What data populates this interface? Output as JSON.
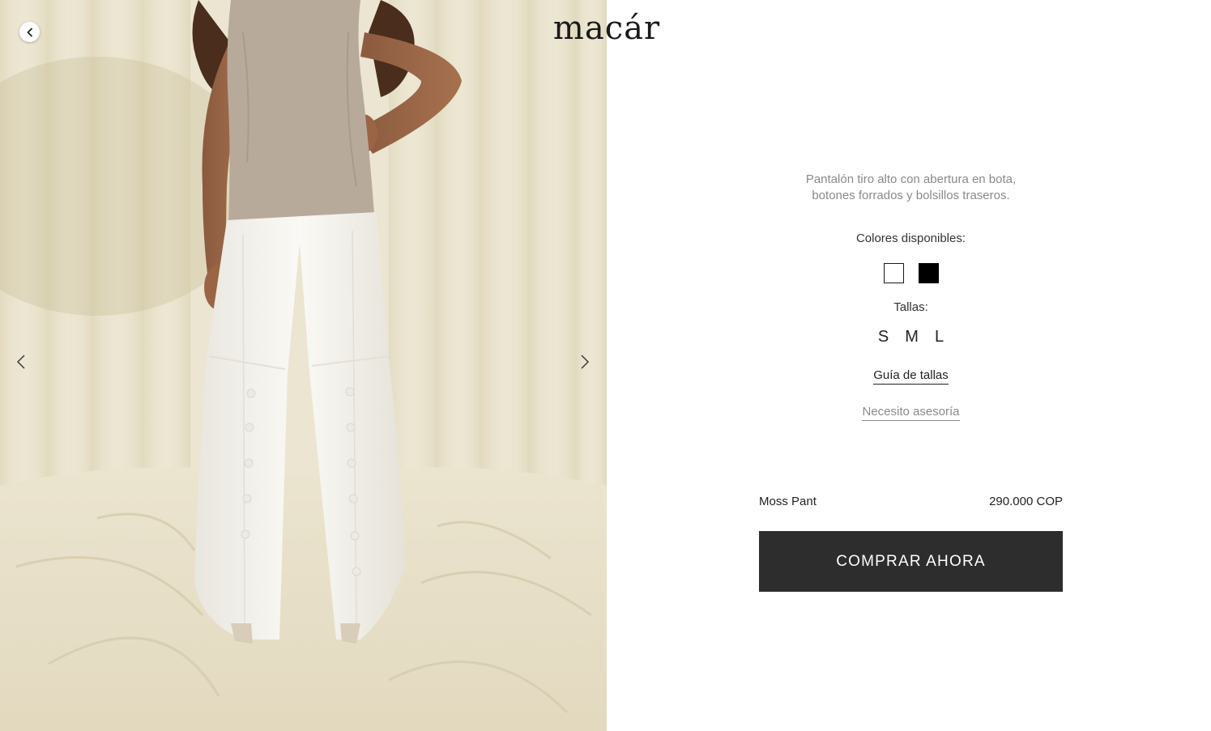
{
  "brand": {
    "logo_text": "macár"
  },
  "navigation": {
    "back_icon": "chevron-left-icon",
    "prev_icon": "chevron-left-icon",
    "next_icon": "chevron-right-icon"
  },
  "product": {
    "description_line1": "Pantalón tiro alto con abertura en bota,",
    "description_line2": "botones forrados y bolsillos traseros.",
    "colors_label": "Colores disponibles:",
    "colors": [
      {
        "name": "white",
        "hex": "#ffffff"
      },
      {
        "name": "black",
        "hex": "#000000"
      }
    ],
    "sizes_label": "Tallas:",
    "sizes": [
      "S",
      "M",
      "L"
    ],
    "size_guide_label": "Guía de tallas",
    "advice_label": "Necesito asesoría",
    "name": "Moss Pant",
    "price": "290.000 COP",
    "buy_label": "COMPRAR AHORA"
  },
  "colors": {
    "button_bg": "#2d2d2d",
    "muted_text": "#8a8a8a",
    "body_text": "#222222",
    "photo_background": "#ebe5d1",
    "top_garment": "#b8aa9b",
    "pants_garment": "#f6f4ef"
  }
}
